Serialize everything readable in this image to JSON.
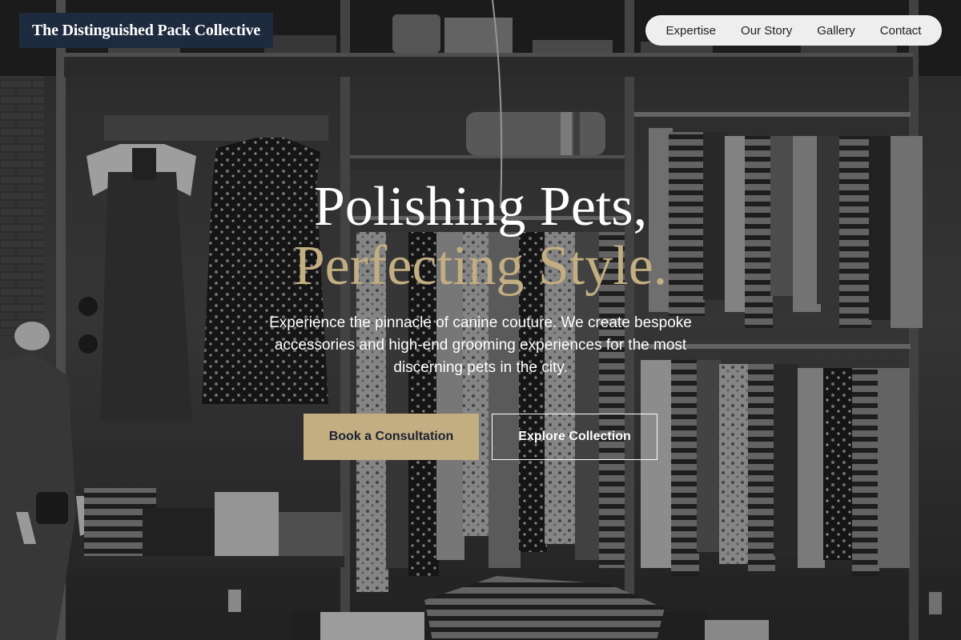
{
  "brand": {
    "name": "The Distinguished Pack Collective"
  },
  "nav": {
    "items": [
      {
        "label": "Expertise"
      },
      {
        "label": "Our Story"
      },
      {
        "label": "Gallery"
      },
      {
        "label": "Contact"
      }
    ]
  },
  "hero": {
    "headline_line1": "Polishing Pets,",
    "headline_line2": "Perfecting Style.",
    "lede": "Experience the pinnacle of canine couture. We create bespoke accessories and high-end grooming experiences for the most discerning pets in the city.",
    "primary_cta": "Book a Consultation",
    "secondary_cta": "Explore Collection"
  },
  "colors": {
    "brand_bg": "#1e2a3d",
    "accent_gold": "#c3ae82",
    "nav_bg": "#eeeeee"
  }
}
